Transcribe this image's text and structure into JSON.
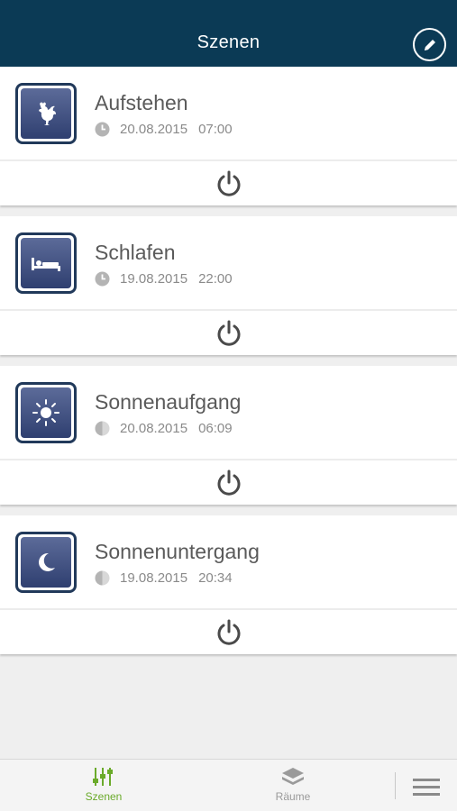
{
  "header": {
    "title": "Szenen",
    "edit_icon": "pencil-icon",
    "background_color": "#0b3a55"
  },
  "scenes": [
    {
      "name": "Aufstehen",
      "icon": "rooster-icon",
      "meta_icon": "clock-icon",
      "date": "20.08.2015",
      "time": "07:00"
    },
    {
      "name": "Schlafen",
      "icon": "bed-icon",
      "meta_icon": "clock-icon",
      "date": "19.08.2015",
      "time": "22:00"
    },
    {
      "name": "Sonnenaufgang",
      "icon": "sun-icon",
      "meta_icon": "half-moon-icon",
      "date": "20.08.2015",
      "time": "06:09"
    },
    {
      "name": "Sonnenuntergang",
      "icon": "moon-icon",
      "meta_icon": "half-moon-icon",
      "date": "19.08.2015",
      "time": "20:34"
    }
  ],
  "nav": {
    "tabs": [
      {
        "label": "Szenen",
        "icon": "sliders-icon",
        "active": true
      },
      {
        "label": "Räume",
        "icon": "layers-icon",
        "active": false
      }
    ],
    "menu_icon": "hamburger-menu-icon",
    "active_color": "#6aaa2a"
  }
}
